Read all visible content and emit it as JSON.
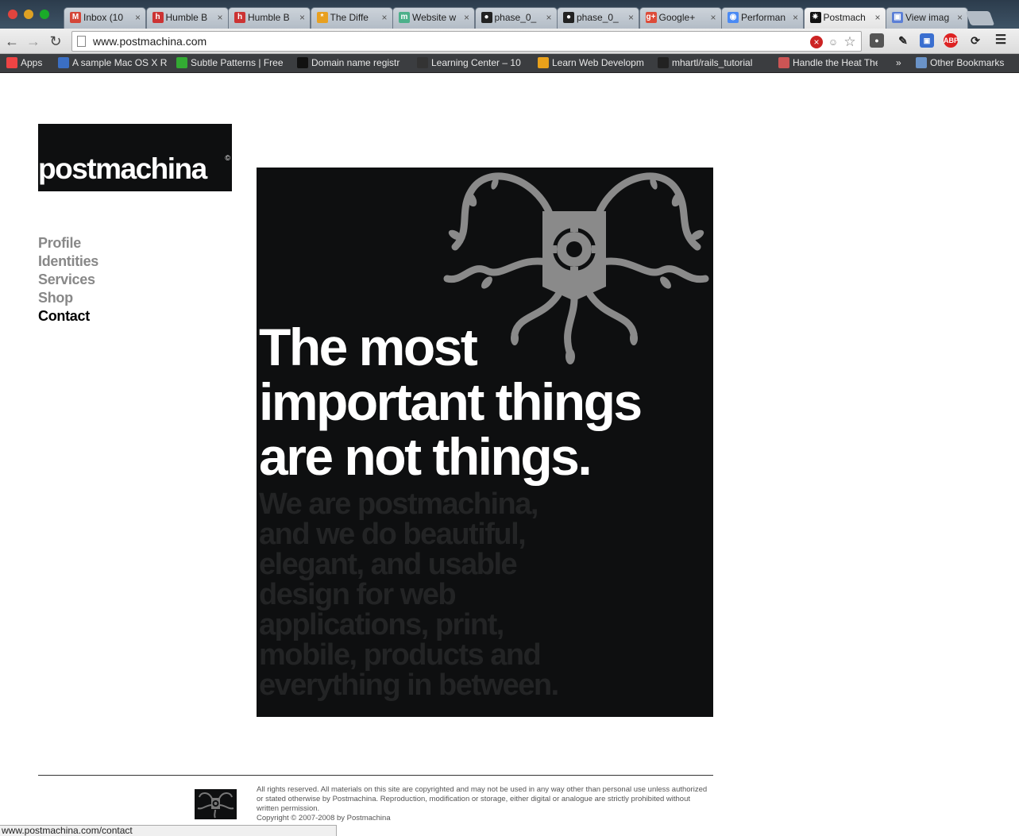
{
  "browser": {
    "tabs": [
      {
        "title": "Inbox (10",
        "icon": "gmail-icon",
        "color": "#d44638",
        "glyph": "M"
      },
      {
        "title": "Humble B",
        "icon": "humble-icon",
        "color": "#c33",
        "glyph": "h"
      },
      {
        "title": "Humble B",
        "icon": "humble-icon",
        "color": "#c33",
        "glyph": "h"
      },
      {
        "title": "The Diffe",
        "icon": "asterisk-icon",
        "color": "#e8a020",
        "glyph": "*"
      },
      {
        "title": "Website w",
        "icon": "m-icon",
        "color": "#4cb08a",
        "glyph": "m"
      },
      {
        "title": "phase_0_",
        "icon": "github-icon",
        "color": "#222",
        "glyph": "●"
      },
      {
        "title": "phase_0_",
        "icon": "github-icon",
        "color": "#222",
        "glyph": "●"
      },
      {
        "title": "Google+",
        "icon": "googleplus-icon",
        "color": "#dd4b39",
        "glyph": "g+"
      },
      {
        "title": "Performan",
        "icon": "chrome-icon",
        "color": "#4a8af4",
        "glyph": "◉"
      },
      {
        "title": "Postmach",
        "icon": "postmachina-icon",
        "color": "#111",
        "glyph": "✷",
        "active": true
      },
      {
        "title": "View imag",
        "icon": "image-icon",
        "color": "#5b7fd6",
        "glyph": "▣"
      }
    ],
    "url": "www.postmachina.com",
    "bookmarks": [
      {
        "label": "Apps",
        "icon": "apps-grid-icon",
        "color": "#e44"
      },
      {
        "label": "A sample Mac OS X R",
        "icon": "a-icon",
        "color": "#3b6fc4"
      },
      {
        "label": "Subtle Patterns | Free",
        "icon": "subtle-patterns-icon",
        "color": "#3a3"
      },
      {
        "label": "Domain name registr",
        "icon": "gandi-icon",
        "color": "#111"
      },
      {
        "label": "Learning Center – 10",
        "icon": "wp-icon",
        "color": "#333"
      },
      {
        "label": "Learn Web Developm",
        "icon": "o-icon",
        "color": "#e9a11b"
      },
      {
        "label": "mhartl/rails_tutorial",
        "icon": "github-icon",
        "color": "#222"
      },
      {
        "label": "Handle the Heat The",
        "icon": "flame-icon",
        "color": "#c55"
      },
      {
        "label": "Other Bookmarks",
        "icon": "folder-icon",
        "color": "#6a93c8"
      }
    ],
    "overflow": "»",
    "status_url": "www.postmachina.com/contact"
  },
  "site": {
    "logo_text": "postmachina",
    "logo_mark": "©",
    "nav": [
      {
        "label": "Profile",
        "active": false
      },
      {
        "label": "Identities",
        "active": false
      },
      {
        "label": "Services",
        "active": false
      },
      {
        "label": "Shop",
        "active": false
      },
      {
        "label": "Contact",
        "active": true
      }
    ],
    "headline": "The most important things are not things.",
    "tagline": "We are postmachina, and we do beautiful, elegant, and usable design for web applications, print, mobile, products and everything in between.",
    "footer": {
      "legal": "All rights reserved. All materials on this site are copyrighted and may not be used in any way other than personal use unless authorized or stated otherwise by Postmachina. Reproduction, modification or storage, either digital or analogue are strictly prohibited without written permission.",
      "copyright": "Copyright © 2007-2008 by Postmachina"
    },
    "colors": {
      "hero_bg": "#0e0f10",
      "graphic": "#8a8a8a",
      "tagline": "#232425",
      "nav_inactive": "#888888",
      "nav_active": "#000000"
    }
  }
}
